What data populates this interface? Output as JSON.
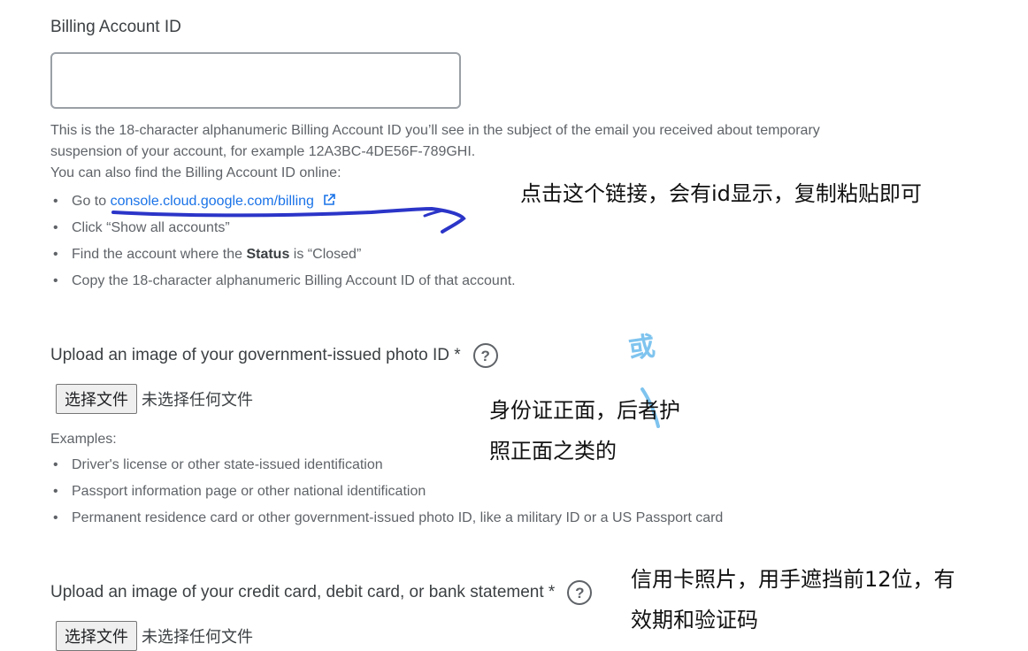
{
  "billing": {
    "title": "Billing Account ID",
    "input_value": "",
    "help_line1": "This is the 18-character alphanumeric Billing Account ID you’ll see in the subject of the email you received about temporary",
    "help_line2": "suspension of your account, for example 12A3BC-4DE56F-789GHI.",
    "help_line3": "You can also find the Billing Account ID online:",
    "steps": {
      "go_to_prefix": "Go to ",
      "link_text": "console.cloud.google.com/billing",
      "click": "Click “Show all accounts”",
      "find_prefix": "Find the account where the ",
      "find_bold": "Status",
      "find_suffix": " is “Closed”",
      "copy": "Copy the 18-character alphanumeric Billing Account ID of that account."
    }
  },
  "photo_id": {
    "label": "Upload an image of your government-issued photo ID *",
    "help_icon": "?",
    "file_button": "选择文件",
    "file_status": "未选择任何文件",
    "examples_title": "Examples:",
    "examples": [
      "Driver's license or other state-issued identification",
      "Passport information page or other national identification",
      "Permanent residence card or other government-issued photo ID, like a military ID or a US Passport card"
    ]
  },
  "credit_card": {
    "label": "Upload an image of your credit card, debit card, or bank statement *",
    "help_icon": "?",
    "file_button": "选择文件",
    "file_status": "未选择任何文件"
  },
  "annotations": {
    "note_link": "点击这个链接，会有id显示，复制粘贴即可",
    "note_id_line1": "身份证正面，后者护",
    "note_id_line2": "照正面之类的",
    "note_or": "或",
    "note_card_line1": "信用卡照片，用手遮挡前12位，有",
    "note_card_line2": "效期和验证码"
  },
  "colors": {
    "link": "#1a73e8",
    "pen_blue": "#2b35c8",
    "pen_lightblue": "#7fc4ef"
  },
  "icons": {
    "external_link": "external-link-icon",
    "help": "help-icon"
  }
}
